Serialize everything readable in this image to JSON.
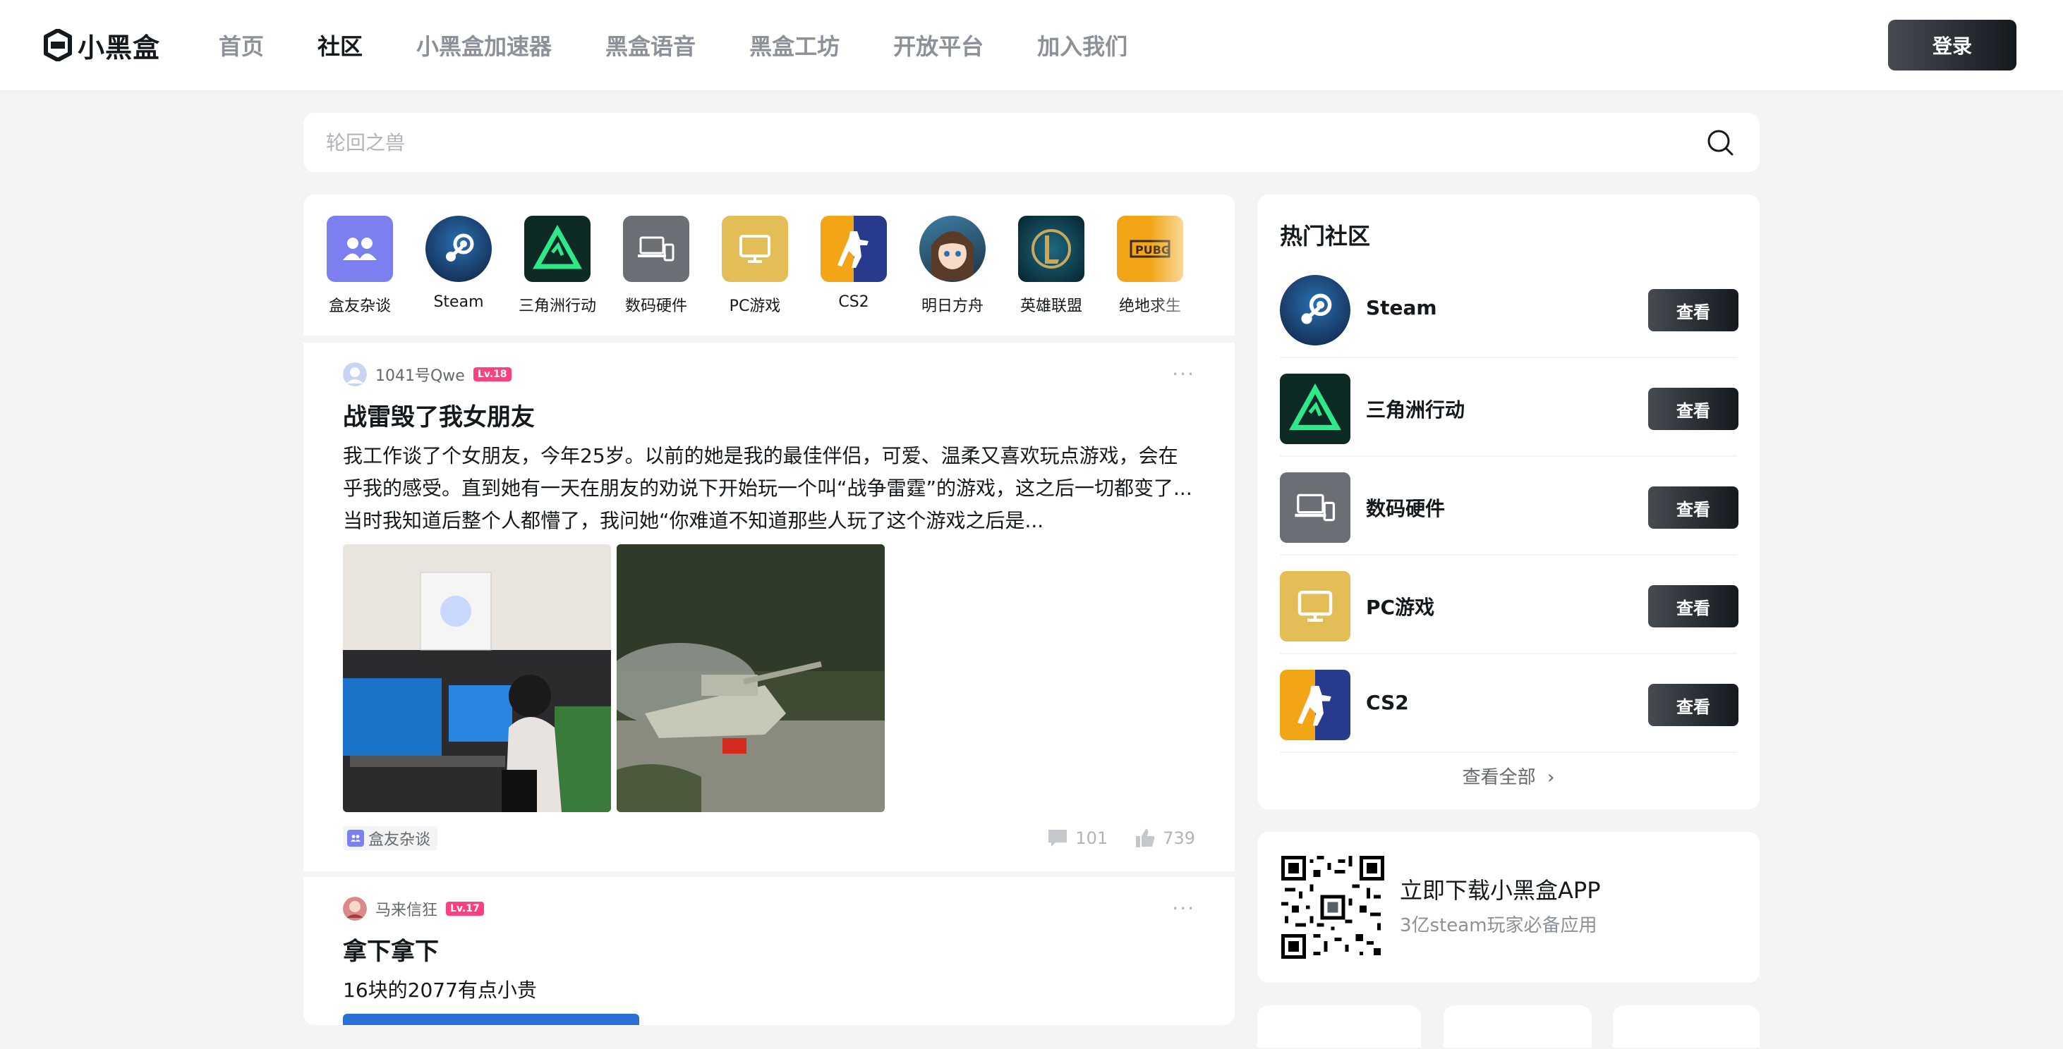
{
  "header": {
    "logo_text": "小黑盒",
    "nav": [
      "首页",
      "社区",
      "小黑盒加速器",
      "黑盒语音",
      "黑盒工坊",
      "开放平台",
      "加入我们"
    ],
    "active_nav": 1,
    "login_label": "登录"
  },
  "search": {
    "placeholder": "轮回之兽"
  },
  "categories": [
    {
      "label": "盒友杂谈",
      "icon": "chat-friends-icon",
      "color": "#7b7ff0"
    },
    {
      "label": "Steam",
      "icon": "steam-icon",
      "color": "#1b3b6f"
    },
    {
      "label": "三角洲行动",
      "icon": "delta-force-icon",
      "color": "#0e2a25"
    },
    {
      "label": "数码硬件",
      "icon": "devices-icon",
      "color": "#6b6f75"
    },
    {
      "label": "PC游戏",
      "icon": "monitor-icon",
      "color": "#e3bd56"
    },
    {
      "label": "CS2",
      "icon": "cs2-icon",
      "color": "#f2a516"
    },
    {
      "label": "明日方舟",
      "icon": "arknights-icon",
      "color": "#2b5d7a"
    },
    {
      "label": "英雄联盟",
      "icon": "lol-icon",
      "color": "#0c3d4c"
    },
    {
      "label": "绝地求生",
      "icon": "pubg-icon",
      "color": "#f2a516"
    }
  ],
  "posts": [
    {
      "author": "1041号Qwe",
      "level": "Lv.18",
      "title": "战雷毁了我女朋友",
      "body": "我工作谈了个女朋友，今年25岁。以前的她是我的最佳伴侣，可爱、温柔又喜欢玩点游戏，会在乎我的感受。直到她有一天在朋友的劝说下开始玩一个叫“战争雷霆”的游戏，这之后一切都变了...当时我知道后整个人都懵了，我问她“你难道不知道那些人玩了这个游戏之后是...",
      "tag": "盒友杂谈",
      "comments": "101",
      "likes": "739"
    },
    {
      "author": "马来信狂",
      "level": "Lv.17",
      "title": "拿下拿下",
      "body": "16块的2077有点小贵"
    }
  ],
  "hot": {
    "title": "热门社区",
    "items": [
      {
        "name": "Steam",
        "icon": "steam-icon",
        "button": "查看"
      },
      {
        "name": "三角洲行动",
        "icon": "delta-force-icon",
        "button": "查看"
      },
      {
        "name": "数码硬件",
        "icon": "devices-icon",
        "button": "查看"
      },
      {
        "name": "PC游戏",
        "icon": "monitor-icon",
        "button": "查看"
      },
      {
        "name": "CS2",
        "icon": "cs2-icon",
        "button": "查看"
      }
    ],
    "view_all": "查看全部"
  },
  "app_promo": {
    "title": "立即下载小黑盒APP",
    "subtitle": "3亿steam玩家必备应用"
  }
}
